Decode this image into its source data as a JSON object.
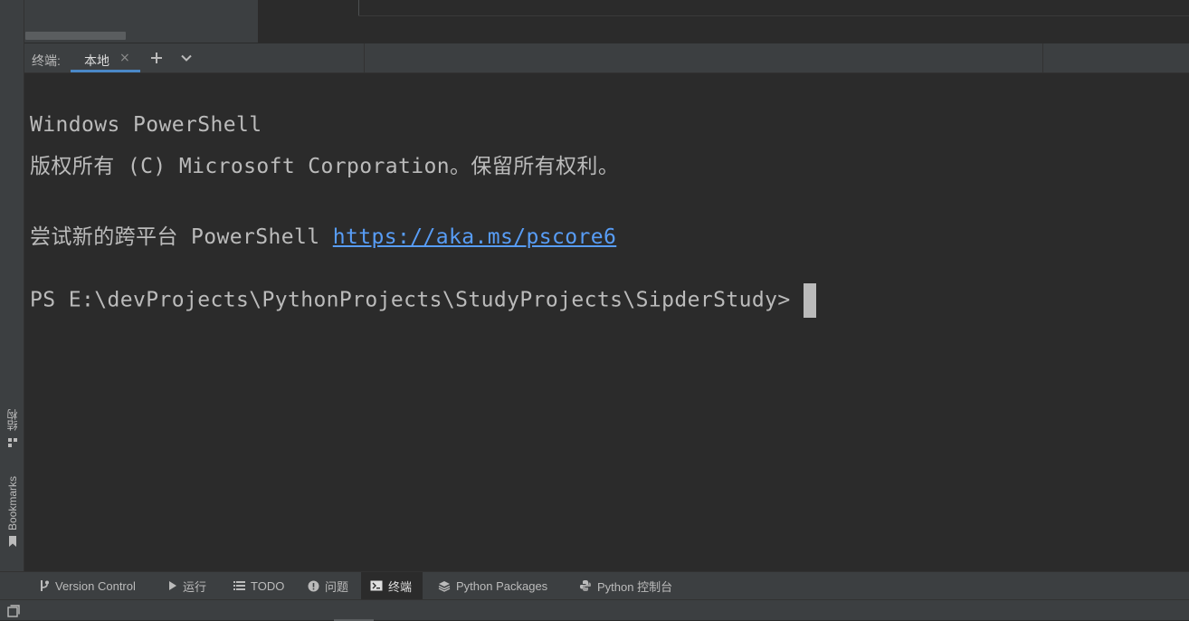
{
  "left_stripe": {
    "structure_label": "结构",
    "bookmarks_label": "Bookmarks"
  },
  "terminal": {
    "title": "终端:",
    "tab_label": "本地",
    "tab_close": "×",
    "add_label": "+",
    "lines": {
      "l1": "Windows PowerShell",
      "l2": "版权所有 (C) Microsoft Corporation。保留所有权利。",
      "l3_prefix": "尝试新的跨平台 PowerShell ",
      "l3_link": "https://aka.ms/pscore6",
      "l4": "PS E:\\devProjects\\PythonProjects\\StudyProjects\\SipderStudy> "
    }
  },
  "bottom_bar": {
    "version_control": "Version Control",
    "run": "运行",
    "todo": "TODO",
    "problems": "问题",
    "terminal": "终端",
    "python_packages": "Python Packages",
    "python_console": "Python 控制台"
  },
  "colors": {
    "accent": "#4a88c7",
    "link": "#589df6",
    "background": "#2b2b2b",
    "panel": "#3c3f41"
  }
}
